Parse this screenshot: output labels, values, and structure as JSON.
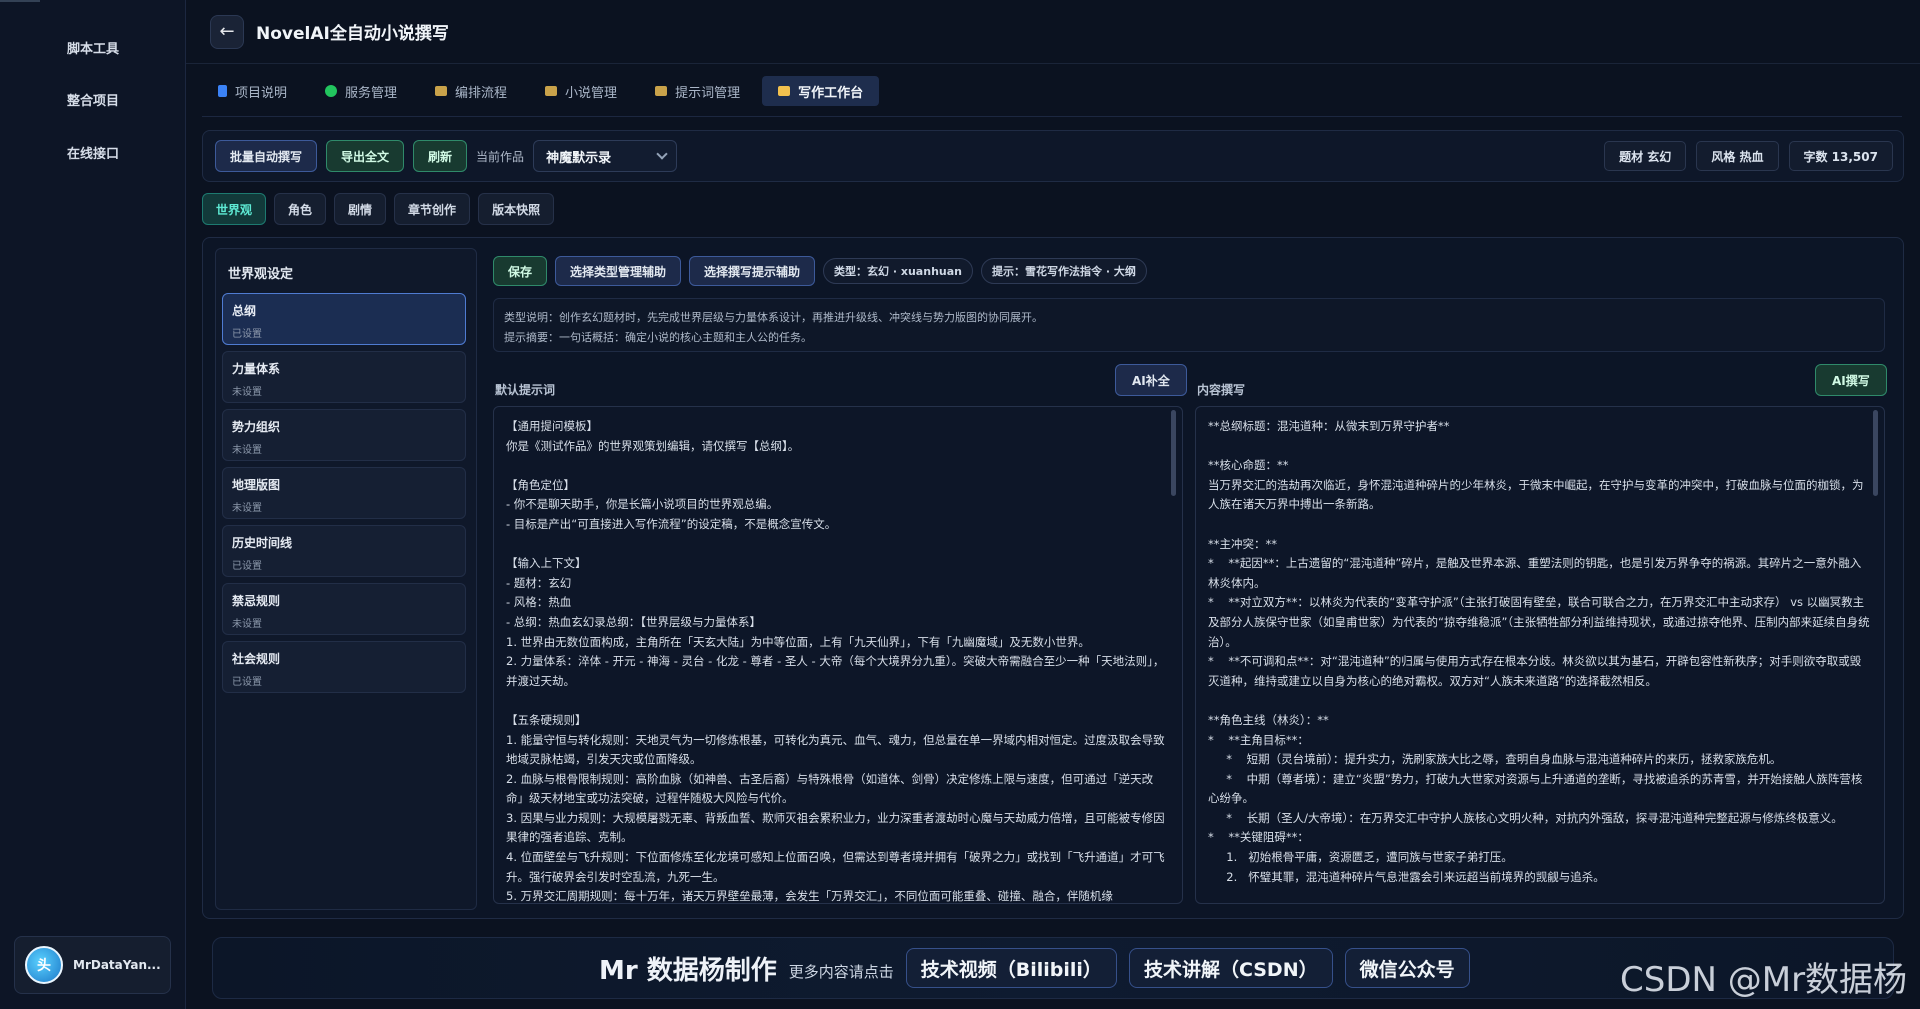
{
  "sidebar": {
    "items": [
      "脚本工具",
      "整合项目",
      "在线接口"
    ],
    "user": {
      "avatar_text": "头",
      "name": "MrDataYan..."
    }
  },
  "header": {
    "back_icon": "←",
    "title": "NovelAI全自动小说撰写"
  },
  "tabs": [
    {
      "label": "项目说明",
      "icon": "book-icon"
    },
    {
      "label": "服务管理",
      "icon": "status-dot-icon"
    },
    {
      "label": "编排流程",
      "icon": "folder-icon"
    },
    {
      "label": "小说管理",
      "icon": "folder-icon"
    },
    {
      "label": "提示词管理",
      "icon": "folder-icon"
    },
    {
      "label": "写作工作台",
      "icon": "folder-icon",
      "active": true
    }
  ],
  "toolbar": {
    "batch_write": "批量自动撰写",
    "export_all": "导出全文",
    "refresh": "刷新",
    "current_work_label": "当前作品",
    "current_work": "神魔默示录",
    "stats": [
      "题材 玄幻",
      "风格 热血",
      "字数 13,507"
    ]
  },
  "subtabs": [
    "世界观",
    "角色",
    "剧情",
    "章节创作",
    "版本快照"
  ],
  "settings_panel": {
    "title": "世界观设定",
    "items": [
      {
        "name": "总纲",
        "status": "已设置",
        "active": true
      },
      {
        "name": "力量体系",
        "status": "未设置"
      },
      {
        "name": "势力组织",
        "status": "未设置"
      },
      {
        "name": "地理版图",
        "status": "未设置"
      },
      {
        "name": "历史时间线",
        "status": "已设置"
      },
      {
        "name": "禁忌规则",
        "status": "未设置"
      },
      {
        "name": "社会规则",
        "status": "已设置"
      }
    ]
  },
  "editor": {
    "save": "保存",
    "select_type_assist": "选择类型管理辅助",
    "select_prompt_assist": "选择撰写提示辅助",
    "type_pill": "类型：玄幻 · xuanhuan",
    "prompt_pill": "提示：雪花写作法指令 · 大纲",
    "info_line1": "类型说明：创作玄幻题材时，先完成世界层级与力量体系设计，再推进升级线、冲突线与势力版图的协同展开。",
    "info_line2": "提示摘要：一句话概括：确定小说的核心主题和主人公的任务。",
    "left_label": "默认提示词",
    "left_ai": "AI补全",
    "right_label": "内容撰写",
    "right_ai": "AI撰写",
    "prompt_text": "【通用提问模板】\n你是《测试作品》的世界观策划编辑，请仅撰写【总纲】。\n\n【角色定位】\n- 你不是聊天助手，你是长篇小说项目的世界观总编。\n- 目标是产出“可直接进入写作流程”的设定稿，不是概念宣传文。\n\n【输入上下文】\n- 题材：玄幻\n- 风格：热血\n- 总纲：热血玄幻录总纲：【世界层级与力量体系】\n1. 世界由无数位面构成，主角所在「天玄大陆」为中等位面，上有「九天仙界」，下有「九幽魔域」及无数小世界。\n2. 力量体系：淬体 - 开元 - 神海 - 灵台 - 化龙 - 尊者 - 圣人 - 大帝（每个大境界分九重）。突破大帝需融合至少一种「天地法则」，并渡过天劫。\n\n【五条硬规则】\n1. 能量守恒与转化规则：天地灵气为一切修炼根基，可转化为真元、血气、魂力，但总量在单一界域内相对恒定。过度汲取会导致地域灵脉枯竭，引发天灾或位面降级。\n2. 血脉与根骨限制规则：高阶血脉（如神兽、古圣后裔）与特殊根骨（如道体、剑骨）决定修炼上限与速度，但可通过「逆天改命」级天材地宝或功法突破，过程伴随极大风险与代价。\n3. 因果与业力规则：大规模屠戮无辜、背叛血誓、欺师灭祖会累积业力，业力深重者渡劫时心魔与天劫威力倍增，且可能被专修因果律的强者追踪、克制。\n4. 位面壁垒与飞升规则：下位面修炼至化龙境可感知上位面召唤，但需达到尊者境并拥有「破界之力」或找到「飞升通道」才可飞升。强行破界会引发时空乱流，九死一生。\n5. 万界交汇周期规则：每十万年，诸天万界壁垒最薄，会发生「万界交汇」，不同位面可能重叠、碰撞、融合，伴随机缘",
    "content_text": "**总纲标题：混沌道种：从微末到万界守护者**\n\n**核心命题：**\n当万界交汇的浩劫再次临近，身怀混沌道种碎片的少年林炎，于微末中崛起，在守护与变革的冲突中，打破血脉与位面的枷锁，为人族在诸天万界中搏出一条新路。\n\n**主冲突：**\n*    **起因**：上古遗留的“混沌道种”碎片，是触及世界本源、重塑法则的钥匙，也是引发万界争夺的祸源。其碎片之一意外融入林炎体内。\n*    **对立双方**：以林炎为代表的“变革守护派”（主张打破固有壁垒，联合可联合之力，在万界交汇中主动求存） vs 以幽冥教主及部分人族保守世家（如皇甫世家）为代表的“掠夺维稳派”（主张牺牲部分利益维持现状，或通过掠夺他界、压制内部来延续自身统治）。\n*    **不可调和点**：对“混沌道种”的归属与使用方式存在根本分歧。林炎欲以其为基石，开辟包容性新秩序；对手则欲夺取或毁灭道种，维持或建立以自身为核心的绝对霸权。双方对“人族未来道路”的选择截然相反。\n\n**角色主线（林炎）：**\n*    **主角目标**：\n     *    短期（灵台境前）：提升实力，洗刷家族大比之辱，查明自身血脉与混沌道种碎片的来历，拯救家族危机。\n     *    中期（尊者境）：建立“炎盟”势力，打破九大世家对资源与上升通道的垄断，寻找被追杀的苏青雪，并开始接触人族阵营核心纷争。\n     *    长期（圣人/大帝境）：在万界交汇中守护人族核心文明火种，对抗内外强敌，探寻混沌道种完整起源与修炼终极意义。\n*    **关键阻碍**：\n     1.   初始根骨平庸，资源匮乏，遭同族与世家子弟打压。\n     2.   怀璧其罪，混沌道种碎片气息泄露会引来远超当前境界的觊觎与追杀。"
  },
  "footer": {
    "brand": "Mr 数据杨制作",
    "brand_sub": "更多内容请点击",
    "links": [
      "技术视频（Bilibili）",
      "技术讲解（CSDN）",
      "微信公众号"
    ]
  },
  "watermark": "CSDN @Mr数据杨"
}
